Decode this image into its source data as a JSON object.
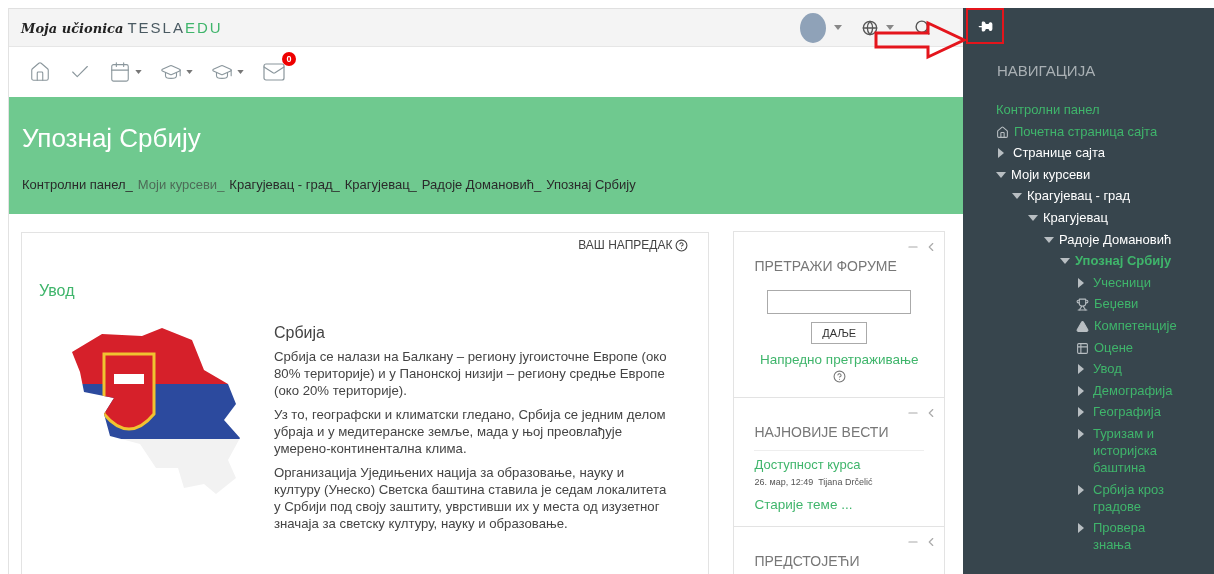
{
  "header": {
    "logo_script": "Moja učionica",
    "logo_brand": "TESLA",
    "logo_brand_accent": "EDU"
  },
  "toolbar": {
    "message_count": "0"
  },
  "banner": {
    "title": "Упознај Србију",
    "breadcrumb": [
      {
        "label": "Контролни панел",
        "separator": "_",
        "link": true
      },
      {
        "label": "Моји курсеви",
        "separator": "_",
        "link": false
      },
      {
        "label": "Крагујевац - град",
        "separator": "_",
        "link": true
      },
      {
        "label": "Крагујевац",
        "separator": "_",
        "link": true
      },
      {
        "label": "Радоје Домановић",
        "separator": "_",
        "link": true
      },
      {
        "label": "Упознај Србију",
        "link": true
      }
    ]
  },
  "progress": {
    "label": "ВАШ НАПРЕДАК"
  },
  "section": {
    "title": "Увод",
    "heading": "Србија",
    "paragraphs": [
      "Србија се налази на Балкану – региону југоисточне Европе (око 80% територије) и у Панонској низији – региону средње Европе (око 20% територије).",
      "Уз то, географски и климатски гледано, Србија се једним делом убраја и у медитеранске земље, мада у њој преовлађује умерено-континентална клима.",
      "Организација Уједињених нација за образовање, науку и културу (Унеско) Светска баштина ставила је седам локалитета у Србији под своју заштиту, уврстивши их у места од изузетног значаја за светску културу, науку и образовање."
    ]
  },
  "blocks": [
    {
      "kind": "search",
      "title": "ПРЕТРАЖИ ФОРУМЕ",
      "button": "ДАЉЕ",
      "link": "Напредно претраживање"
    },
    {
      "kind": "news",
      "title": "НАЈНОВИЈЕ ВЕСТИ",
      "items": [
        {
          "title": "Доступност курса",
          "date": "26. мар, 12:49",
          "author": "Tijana Drčelić"
        }
      ],
      "more": "Старије теме ..."
    },
    {
      "kind": "events",
      "title": "ПРЕДСТОЈЕЋИ"
    }
  ],
  "navigation": {
    "title": "НАВИГАЦИЈА",
    "items": [
      {
        "label": "Контролни панел",
        "kind": "plain",
        "link": true,
        "current": false
      },
      {
        "label": "Почетна страница сајта",
        "kind": "home",
        "link": true,
        "current": false
      },
      {
        "label": "Странице сајта",
        "kind": "branch",
        "expanded": false,
        "link": false,
        "current": false
      },
      {
        "label": "Моји курсеви",
        "kind": "branch",
        "expanded": true,
        "link": false,
        "current": false,
        "children": [
          {
            "label": "Крагујевац - град",
            "kind": "branch",
            "expanded": true,
            "link": false,
            "current": false,
            "children": [
              {
                "label": "Крагујевац",
                "kind": "branch",
                "expanded": true,
                "link": false,
                "current": false,
                "children": [
                  {
                    "label": "Радоје Домановић",
                    "kind": "branch",
                    "expanded": true,
                    "link": false,
                    "current": false,
                    "children": [
                      {
                        "label": "Упознај Србију",
                        "kind": "branch",
                        "expanded": true,
                        "link": true,
                        "current": true,
                        "children": [
                          {
                            "label": "Учесници",
                            "kind": "branch",
                            "expanded": false,
                            "link": true,
                            "current": false
                          },
                          {
                            "label": "Беџеви",
                            "kind": "trophy",
                            "link": true,
                            "current": false
                          },
                          {
                            "label": "Компетенције",
                            "kind": "competency",
                            "link": true,
                            "current": false
                          },
                          {
                            "label": "Оцене",
                            "kind": "grades",
                            "link": true,
                            "current": false
                          },
                          {
                            "label": "Увод",
                            "kind": "branch",
                            "expanded": false,
                            "link": true,
                            "current": false
                          },
                          {
                            "label": "Демографија",
                            "kind": "branch",
                            "expanded": false,
                            "link": true,
                            "current": false
                          },
                          {
                            "label": "Географија",
                            "kind": "branch",
                            "expanded": false,
                            "link": true,
                            "current": false
                          },
                          {
                            "label": "Туризам и историјска баштина",
                            "kind": "branch",
                            "expanded": false,
                            "link": true,
                            "current": false
                          },
                          {
                            "label": "Србија кроз градове",
                            "kind": "branch",
                            "expanded": false,
                            "link": true,
                            "current": false
                          },
                          {
                            "label": "Провера знања",
                            "kind": "branch",
                            "expanded": false,
                            "link": true,
                            "current": false
                          }
                        ]
                      }
                    ]
                  }
                ]
              }
            ]
          }
        ]
      }
    ]
  }
}
